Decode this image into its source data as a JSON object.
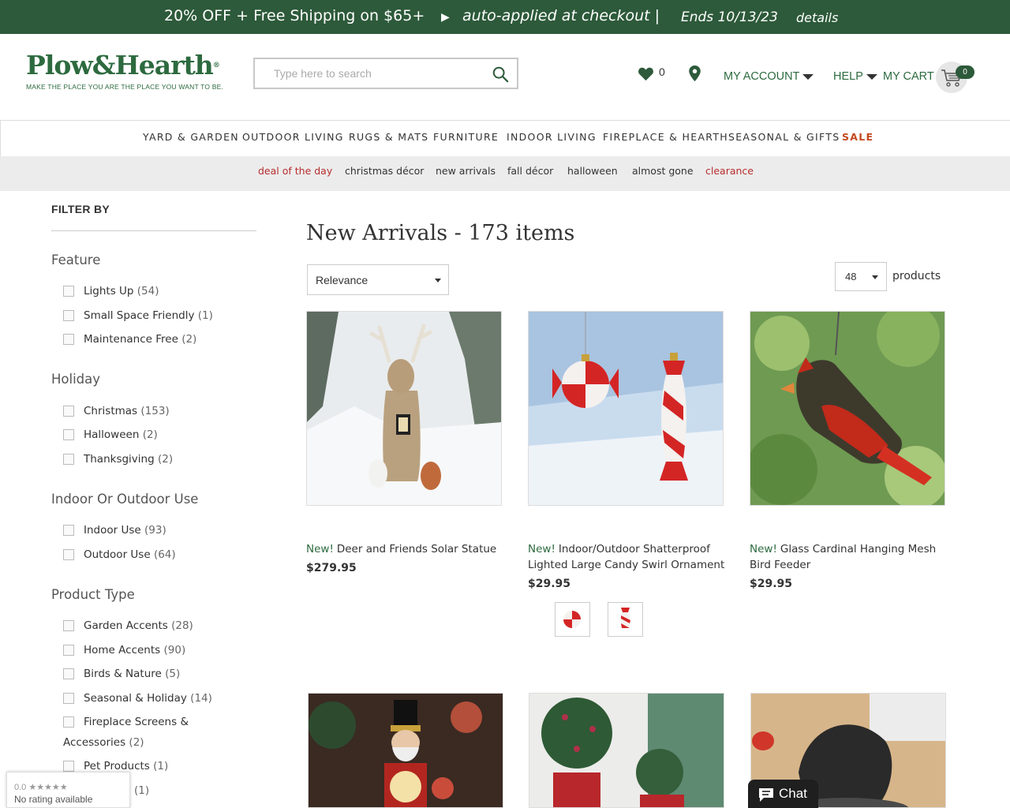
{
  "promo": {
    "offer": "20% OFF + Free Shipping on $65+",
    "arrow": "▶",
    "auto": "auto-applied at checkout |",
    "ends": "Ends 10/13/23",
    "details": "details"
  },
  "header": {
    "logo_name": "Plow&Hearth",
    "logo_reg": "®",
    "logo_tagline": "MAKE THE PLACE YOU ARE THE PLACE YOU WANT TO BE.",
    "search_placeholder": "Type here to search",
    "wishlist_count": "0",
    "my_account": "MY ACCOUNT",
    "help": "HELP",
    "my_cart": "MY CART",
    "cart_count": "0"
  },
  "main_nav": [
    "YARD & GARDEN",
    "OUTDOOR LIVING",
    "RUGS & MATS",
    "FURNITURE",
    "INDOOR LIVING",
    "FIREPLACE & HEARTH",
    "SEASONAL & GIFTS",
    "SALE"
  ],
  "sub_nav": [
    "deal of the day",
    "christmas décor",
    "new arrivals",
    "fall décor",
    "halloween",
    "almost gone",
    "clearance"
  ],
  "filters": {
    "title": "FILTER BY",
    "groups": [
      {
        "title": "Feature",
        "options": [
          {
            "label": "Lights Up",
            "count": "(54)"
          },
          {
            "label": "Small Space Friendly",
            "count": "(1)"
          },
          {
            "label": "Maintenance Free",
            "count": "(2)"
          }
        ]
      },
      {
        "title": "Holiday",
        "options": [
          {
            "label": "Christmas",
            "count": "(153)"
          },
          {
            "label": "Halloween",
            "count": "(2)"
          },
          {
            "label": "Thanksgiving",
            "count": "(2)"
          }
        ]
      },
      {
        "title": "Indoor Or Outdoor Use",
        "options": [
          {
            "label": "Indoor Use",
            "count": "(93)"
          },
          {
            "label": "Outdoor Use",
            "count": "(64)"
          }
        ]
      },
      {
        "title": "Product Type",
        "options": [
          {
            "label": "Garden Accents",
            "count": "(28)"
          },
          {
            "label": "Home Accents",
            "count": "(90)"
          },
          {
            "label": "Birds & Nature",
            "count": "(5)"
          },
          {
            "label": "Seasonal & Holiday",
            "count": "(14)"
          },
          {
            "label": "Fireplace Screens & Accessories",
            "count": "(2)"
          },
          {
            "label": "Pet Products",
            "count": "(1)"
          },
          {
            "label": "",
            "count": "(1)"
          }
        ]
      }
    ]
  },
  "listing": {
    "title": "New Arrivals - 173 items",
    "sort_value": "Relevance",
    "per_page_value": "48",
    "per_page_label": "products"
  },
  "products": [
    {
      "badge": "New!",
      "name": "Deer and Friends Solar Statue",
      "price": "$279.95"
    },
    {
      "badge": "New!",
      "name": "Indoor/Outdoor Shatterproof Lighted Large Candy Swirl Ornament",
      "price": "$29.95"
    },
    {
      "badge": "New!",
      "name": "Glass Cardinal Hanging Mesh Bird Feeder",
      "price": "$29.95"
    }
  ],
  "google_rating": {
    "stars": "0.0 ★★★★★",
    "text": "No rating available"
  },
  "chat": {
    "label": "Chat"
  },
  "colors": {
    "brand_green": "#2d5a3a",
    "sale_red": "#c4481d",
    "deal_red": "#b72d2d"
  }
}
